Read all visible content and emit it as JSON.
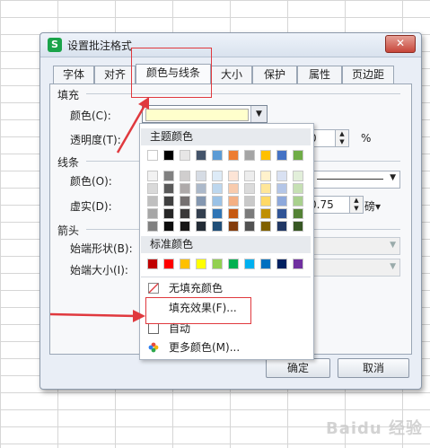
{
  "dialog": {
    "title": "设置批注格式",
    "close_icon": "close-icon",
    "app_icon": "S",
    "tabs": [
      {
        "label": "字体"
      },
      {
        "label": "对齐"
      },
      {
        "label": "颜色与线条",
        "active": true
      },
      {
        "label": "大小"
      },
      {
        "label": "保护"
      },
      {
        "label": "属性"
      },
      {
        "label": "页边距"
      }
    ],
    "fill": {
      "section": "填充",
      "color_label": "颜色(C):",
      "color_value": "#ffffcc",
      "transparency_label": "透明度(T):",
      "transparency_value": "0",
      "transparency_unit": "%"
    },
    "line": {
      "section": "线条",
      "color_label": "颜色(O):",
      "dash_label": "虚实(D):",
      "weight_value": "0.75",
      "weight_unit": "磅▾"
    },
    "arrow": {
      "section": "箭头",
      "begin_style_label": "始端形状(B):",
      "begin_size_label": "始端大小(I):"
    },
    "ok_label": "确定",
    "cancel_label": "取消"
  },
  "color_popup": {
    "theme_heading": "主题颜色",
    "theme_row": [
      "#ffffff",
      "#000000",
      "#e7e6e6",
      "#44546a",
      "#5b9bd5",
      "#ed7d31",
      "#a5a5a5",
      "#ffc000",
      "#4472c4",
      "#70ad47"
    ],
    "theme_shades": [
      [
        "#f2f2f2",
        "#808080",
        "#d0cece",
        "#d6dce4",
        "#ddebf7",
        "#fce4d6",
        "#ededed",
        "#fff2cc",
        "#d9e1f2",
        "#e2efda"
      ],
      [
        "#d9d9d9",
        "#595959",
        "#aeaaaa",
        "#acb9ca",
        "#bdd7ee",
        "#f8cbad",
        "#dbdbdb",
        "#ffe699",
        "#b4c6e7",
        "#c6e0b4"
      ],
      [
        "#bfbfbf",
        "#404040",
        "#757171",
        "#8497b0",
        "#9bc2e6",
        "#f4b084",
        "#c9c9c9",
        "#ffd966",
        "#8ea9db",
        "#a9d08e"
      ],
      [
        "#a6a6a6",
        "#262626",
        "#3a3838",
        "#333f4f",
        "#2f75b5",
        "#c65911",
        "#7b7b7b",
        "#bf8f00",
        "#305496",
        "#548235"
      ],
      [
        "#808080",
        "#0d0d0d",
        "#171616",
        "#222b35",
        "#1f4e78",
        "#833c0c",
        "#525252",
        "#806000",
        "#203764",
        "#375623"
      ]
    ],
    "standard_heading": "标准颜色",
    "standard_row": [
      "#c00000",
      "#ff0000",
      "#ffc000",
      "#ffff00",
      "#92d050",
      "#00b050",
      "#00b0f0",
      "#0070c0",
      "#002060",
      "#7030a0"
    ],
    "menu": [
      {
        "label": "无填充颜色",
        "icon": "no-fill-icon"
      },
      {
        "label": "填充效果(F)...",
        "icon": ""
      },
      {
        "label": "自动",
        "icon": "auto-color-icon"
      },
      {
        "label": "更多颜色(M)...",
        "icon": "color-wheel-icon"
      }
    ]
  },
  "annotation_color": "#e0393e",
  "watermark": "Baidu 经验"
}
